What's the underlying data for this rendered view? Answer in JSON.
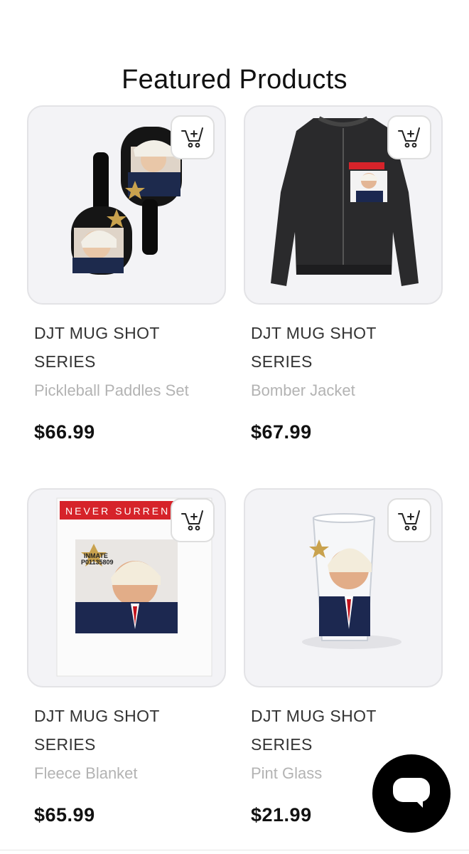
{
  "page": {
    "title": "Featured Products"
  },
  "products": [
    {
      "brand": "DJT MUG SHOT SERIES",
      "name": "Pickleball Paddles Set",
      "price": "$66.99",
      "image_icon": "pickleball-paddles-image"
    },
    {
      "brand": "DJT MUG SHOT SERIES",
      "name": "Bomber Jacket",
      "price": "$67.99",
      "image_icon": "bomber-jacket-image"
    },
    {
      "brand": "DJT MUG SHOT SERIES",
      "name": "Fleece Blanket",
      "price": "$65.99",
      "image_icon": "fleece-blanket-image",
      "image_text": {
        "banner": "NEVER SURRENDER",
        "badge_line1": "INMATE",
        "badge_line2": "P01135809"
      }
    },
    {
      "brand": "DJT MUG SHOT SERIES",
      "name": "Pint Glass",
      "price": "$21.99",
      "image_icon": "pint-glass-image"
    }
  ],
  "icons": {
    "add_to_cart": "cart-plus-icon",
    "chat": "chat-bubble-icon"
  },
  "colors": {
    "card_bg": "#f3f3f6",
    "price": "#111111",
    "name": "#b3b3b3",
    "chat_bg": "#000000",
    "banner_red": "#d6232a"
  }
}
